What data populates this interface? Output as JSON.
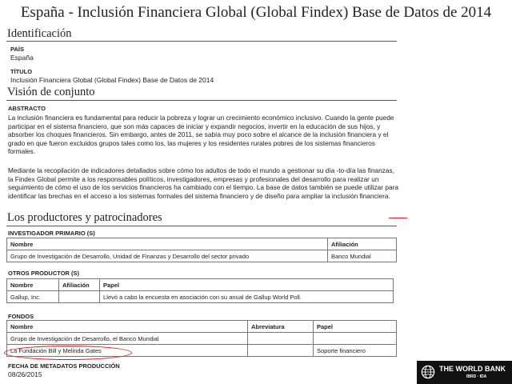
{
  "title": "España - Inclusión Financiera Global (Global Findex) Base de Datos de 2014",
  "identificacion": {
    "heading": "Identificación",
    "pais_label": "PAÍS",
    "pais_value": "España",
    "titulo_label": "TÍTULO",
    "titulo_value": "Inclusión Financiera Global (Global Findex) Base de Datos de 2014"
  },
  "vision": {
    "heading": "Visión de conjunto",
    "abstracto_label": "ABSTRACTO",
    "paragraph1": "La inclusión financiera es fundamental para reducir la pobreza y lograr un crecimiento económico inclusivo. Cuando la gente puede participar en el sistema financiero, que son más capaces de iniciar y expandir negocios, invertir en la educación de sus hijos, y absorber los choques financieros. Sin embargo, antes de 2011, se sabía muy poco sobre el alcance de la inclusión financiera y el grado en que fueron excluidos grupos tales como los, las mujeres y los residentes rurales pobres de los sistemas financieros formales.",
    "paragraph2": "Mediante la recopilación de indicadores detallados sobre cómo los adultos de todo el mundo a gestionar su día -to-día las finanzas, la Findex Global permite a los responsables políticos, investigadores, empresas y profesionales del desarrollo para realizar un seguimiento de cómo el uso de los servicios financieros ha cambiado con el tiempo. La base de datos también se puede utilizar para identificar las brechas en el acceso a los sistemas formales del sistema financiero y de diseño para ampliar la inclusión financiera."
  },
  "productores": {
    "heading": "Los productores y patrocinadores",
    "investigador_label": "INVESTIGADOR PRIMARIO (S)",
    "investigador_headers": [
      "Nombre",
      "Afiliación"
    ],
    "investigador_rows": [
      [
        "Grupo de Investigación de Desarrollo, Unidad de Finanzas y Desarrollo del sector privado",
        "Banco Mundial"
      ]
    ],
    "otros_label": "OTROS PRODUCTOR (S)",
    "otros_headers": [
      "Nombre",
      "Afiliación",
      "Papel"
    ],
    "otros_rows": [
      [
        "Gallup, Inc.",
        "",
        "Llevó a cabo la encuesta en asociación con su anual de Gallup World Poll."
      ]
    ],
    "fondos_label": "FONDOS",
    "fondos_headers": [
      "Nombre",
      "Abreviatura",
      "Papel"
    ],
    "fondos_rows": [
      [
        "Grupo de Investigación de Desarrollo, el Banco Mundial",
        "",
        ""
      ],
      [
        "La Fundación Bill y Melinda Gates",
        "",
        "Soporte financiero"
      ]
    ]
  },
  "metadatos": {
    "fecha_label": "FECHA DE METADATOS PRODUCCIÓN",
    "fecha_value": "08/26/2015"
  },
  "logo": {
    "name": "THE WORLD BANK",
    "sub": "IBRD · IDA",
    "icon": "globe-icon"
  },
  "annotation_color": "#d41e1e"
}
